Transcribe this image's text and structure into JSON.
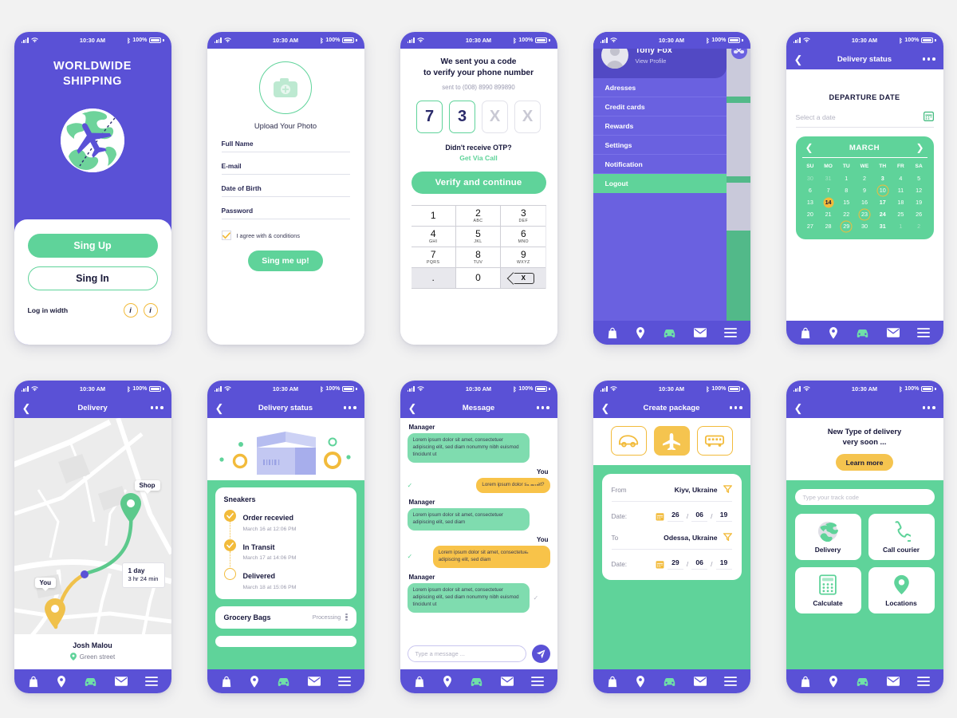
{
  "status_bar": {
    "time": "10:30 AM",
    "battery": "100%"
  },
  "screens": {
    "signup": {
      "title_line1": "WORLDWIDE",
      "title_line2": "SHIPPING",
      "sign_up": "Sing Up",
      "sign_in": "Sing In",
      "login_with": "Log in width",
      "social1": "i",
      "social2": "i"
    },
    "register": {
      "upload_label": "Upload Your Photo",
      "fields": [
        "Full Name",
        "E-mail",
        "Date of Birth",
        "Password"
      ],
      "agree": "I agree with & conditions",
      "submit": "Sing me up!"
    },
    "otp": {
      "heading_line1": "We sent you a code",
      "heading_line2": "to verify your phone number",
      "sent_to": "sent to (008) 8990 899890",
      "digits": [
        "7",
        "3",
        "X",
        "X"
      ],
      "question": "Didn't receive OTP?",
      "link": "Get Via Call",
      "button": "Verify and continue",
      "keypad": [
        {
          "num": "1",
          "sub": ""
        },
        {
          "num": "2",
          "sub": "ABC"
        },
        {
          "num": "3",
          "sub": "DEF"
        },
        {
          "num": "4",
          "sub": "GHI"
        },
        {
          "num": "5",
          "sub": "JKL"
        },
        {
          "num": "6",
          "sub": "MNO"
        },
        {
          "num": "7",
          "sub": "PQRS"
        },
        {
          "num": "8",
          "sub": "TUV"
        },
        {
          "num": "9",
          "sub": "WXYZ"
        },
        {
          "num": ".",
          "sub": ""
        },
        {
          "num": "0",
          "sub": ""
        },
        {
          "num": "X",
          "sub": ""
        }
      ]
    },
    "drawer": {
      "user_name": "Tony Fox",
      "view_profile": "View Profile",
      "items": [
        "Adresses",
        "Credit cards",
        "Rewards",
        "Settings",
        "Notification",
        "Logout"
      ],
      "active_item": "Logout"
    },
    "calendar": {
      "nav_title": "Delivery status",
      "section_title": "DEPARTURE DATE",
      "date_placeholder": "Select a date",
      "month": "MARCH",
      "dow": [
        "SU",
        "MO",
        "TU",
        "WE",
        "TH",
        "FR",
        "SA"
      ],
      "days": [
        {
          "d": "30",
          "muted": true
        },
        {
          "d": "31",
          "muted": true
        },
        {
          "d": "1"
        },
        {
          "d": "2"
        },
        {
          "d": "3",
          "bold": true
        },
        {
          "d": "4"
        },
        {
          "d": "5"
        },
        {
          "d": "6"
        },
        {
          "d": "7"
        },
        {
          "d": "8"
        },
        {
          "d": "9"
        },
        {
          "d": "10",
          "ring": true
        },
        {
          "d": "11"
        },
        {
          "d": "12"
        },
        {
          "d": "13"
        },
        {
          "d": "14",
          "sel": true
        },
        {
          "d": "15"
        },
        {
          "d": "16"
        },
        {
          "d": "17",
          "bold": true
        },
        {
          "d": "18"
        },
        {
          "d": "19"
        },
        {
          "d": "20"
        },
        {
          "d": "21"
        },
        {
          "d": "22"
        },
        {
          "d": "23",
          "ring": true
        },
        {
          "d": "24",
          "bold": true
        },
        {
          "d": "25"
        },
        {
          "d": "26"
        },
        {
          "d": "27"
        },
        {
          "d": "28"
        },
        {
          "d": "29",
          "ring": true
        },
        {
          "d": "30"
        },
        {
          "d": "31",
          "bold": true
        },
        {
          "d": "1",
          "muted": true
        },
        {
          "d": "2",
          "muted": true
        }
      ]
    },
    "map": {
      "nav_title": "Delivery",
      "shop_label": "Shop",
      "you_label": "You",
      "eta_days": "1 day",
      "eta_time": "3 hr  24 min",
      "courier_name": "Josh Malou",
      "courier_address": "Green street"
    },
    "tracking": {
      "nav_title": "Delivery status",
      "order_title": "Sneakers",
      "steps": [
        {
          "name": "Order recevied",
          "time": "March 16 at 12:06 PM",
          "state": "done"
        },
        {
          "name": "In Transit",
          "time": "March 17 at 14:06 PM",
          "state": "done"
        },
        {
          "name": "Delivered",
          "time": "March 18 at 15:06 PM",
          "state": "open"
        }
      ],
      "order2_title": "Grocery Bags",
      "order2_status": "Processing"
    },
    "message": {
      "nav_title": "Message",
      "sender_manager": "Manager",
      "sender_you": "You",
      "messages": [
        {
          "from": "manager",
          "text": "Lorem ipsum dolor sit amet, consectetuer adipiscing elit, sed diam nonummy nibh euismod tincidunt ut"
        },
        {
          "from": "you",
          "text": "Lorem ipsum dolor sit amet?"
        },
        {
          "from": "manager",
          "text": "Lorem ipsum dolor sit amet, consectetuer adipiscing elit, sed diam"
        },
        {
          "from": "you",
          "text": "Lorem ipsum dolor sit amet, consectetuer adipiscing elit, sed diam"
        },
        {
          "from": "manager",
          "text": "Lorem ipsum dolor sit amet, consectetuer adipiscing elit, sed diam nonummy nibh euismod tincidunt ut"
        }
      ],
      "input_placeholder": "Type a message ..."
    },
    "create_package": {
      "nav_title": "Create package",
      "modes": [
        "car-icon",
        "plane-icon",
        "bus-icon"
      ],
      "active_mode": "plane-icon",
      "from_label": "From",
      "from_value": "Kiyv, Ukraine",
      "from_date_label": "Date:",
      "from_date": [
        "26",
        "06",
        "19"
      ],
      "to_label": "To",
      "to_value": "Odessa, Ukraine",
      "to_date_label": "Date:",
      "to_date": [
        "29",
        "06",
        "19"
      ]
    },
    "dashboard": {
      "promo_line1": "New Type of delivery",
      "promo_line2": "very soon ...",
      "promo_button": "Learn more",
      "track_placeholder": "Type your track code",
      "tiles": [
        {
          "label": "Delivery",
          "icon": "globe-icon"
        },
        {
          "label": "Call courier",
          "icon": "phone-icon"
        },
        {
          "label": "Calculate",
          "icon": "calculator-icon"
        },
        {
          "label": "Locations",
          "icon": "location-pin-icon"
        }
      ]
    }
  },
  "tabbar": {
    "items": [
      "bag-icon",
      "location-pin-icon",
      "car-icon",
      "mail-icon",
      "menu-icon"
    ],
    "active": "car-icon"
  },
  "colors": {
    "purple": "#5a51d6",
    "green": "#5fd39a",
    "yellow": "#f2bb3b",
    "dark": "#16163a"
  }
}
